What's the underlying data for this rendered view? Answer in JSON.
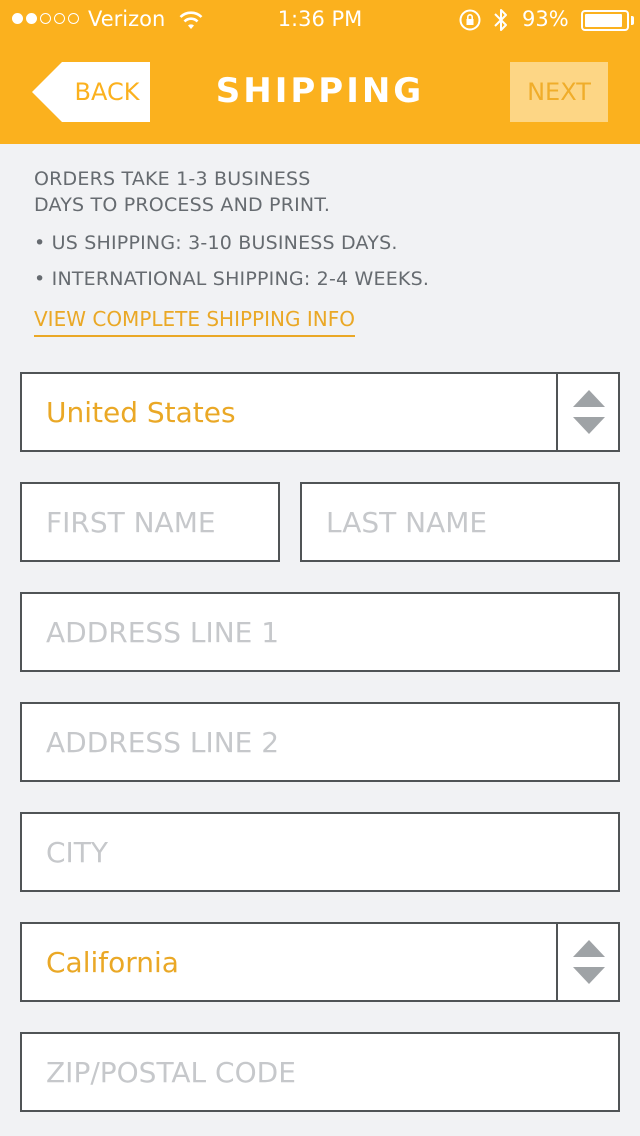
{
  "status_bar": {
    "signal_filled": 2,
    "signal_total": 5,
    "carrier": "Verizon",
    "time": "1:36 PM",
    "battery_percent": "93%",
    "battery_level": 0.93
  },
  "nav": {
    "back_label": "BACK",
    "title": "SHIPPING",
    "next_label": "NEXT"
  },
  "info": {
    "line1": "ORDERS TAKE 1-3 BUSINESS",
    "line2": "DAYS TO PROCESS AND PRINT.",
    "bullet1": "• US SHIPPING: 3-10 BUSINESS DAYS.",
    "bullet2": "• INTERNATIONAL SHIPPING: 2-4 WEEKS.",
    "link": "VIEW COMPLETE SHIPPING INFO"
  },
  "form": {
    "country": "United States",
    "first_name_placeholder": "FIRST NAME",
    "last_name_placeholder": "LAST NAME",
    "address1_placeholder": "ADDRESS LINE 1",
    "address2_placeholder": "ADDRESS LINE 2",
    "city_placeholder": "CITY",
    "state": "California",
    "zip_placeholder": "ZIP/POSTAL CODE"
  },
  "colors": {
    "accent": "#fbb11e",
    "link": "#eaa826",
    "background": "#f1f2f4",
    "border": "#505456"
  }
}
